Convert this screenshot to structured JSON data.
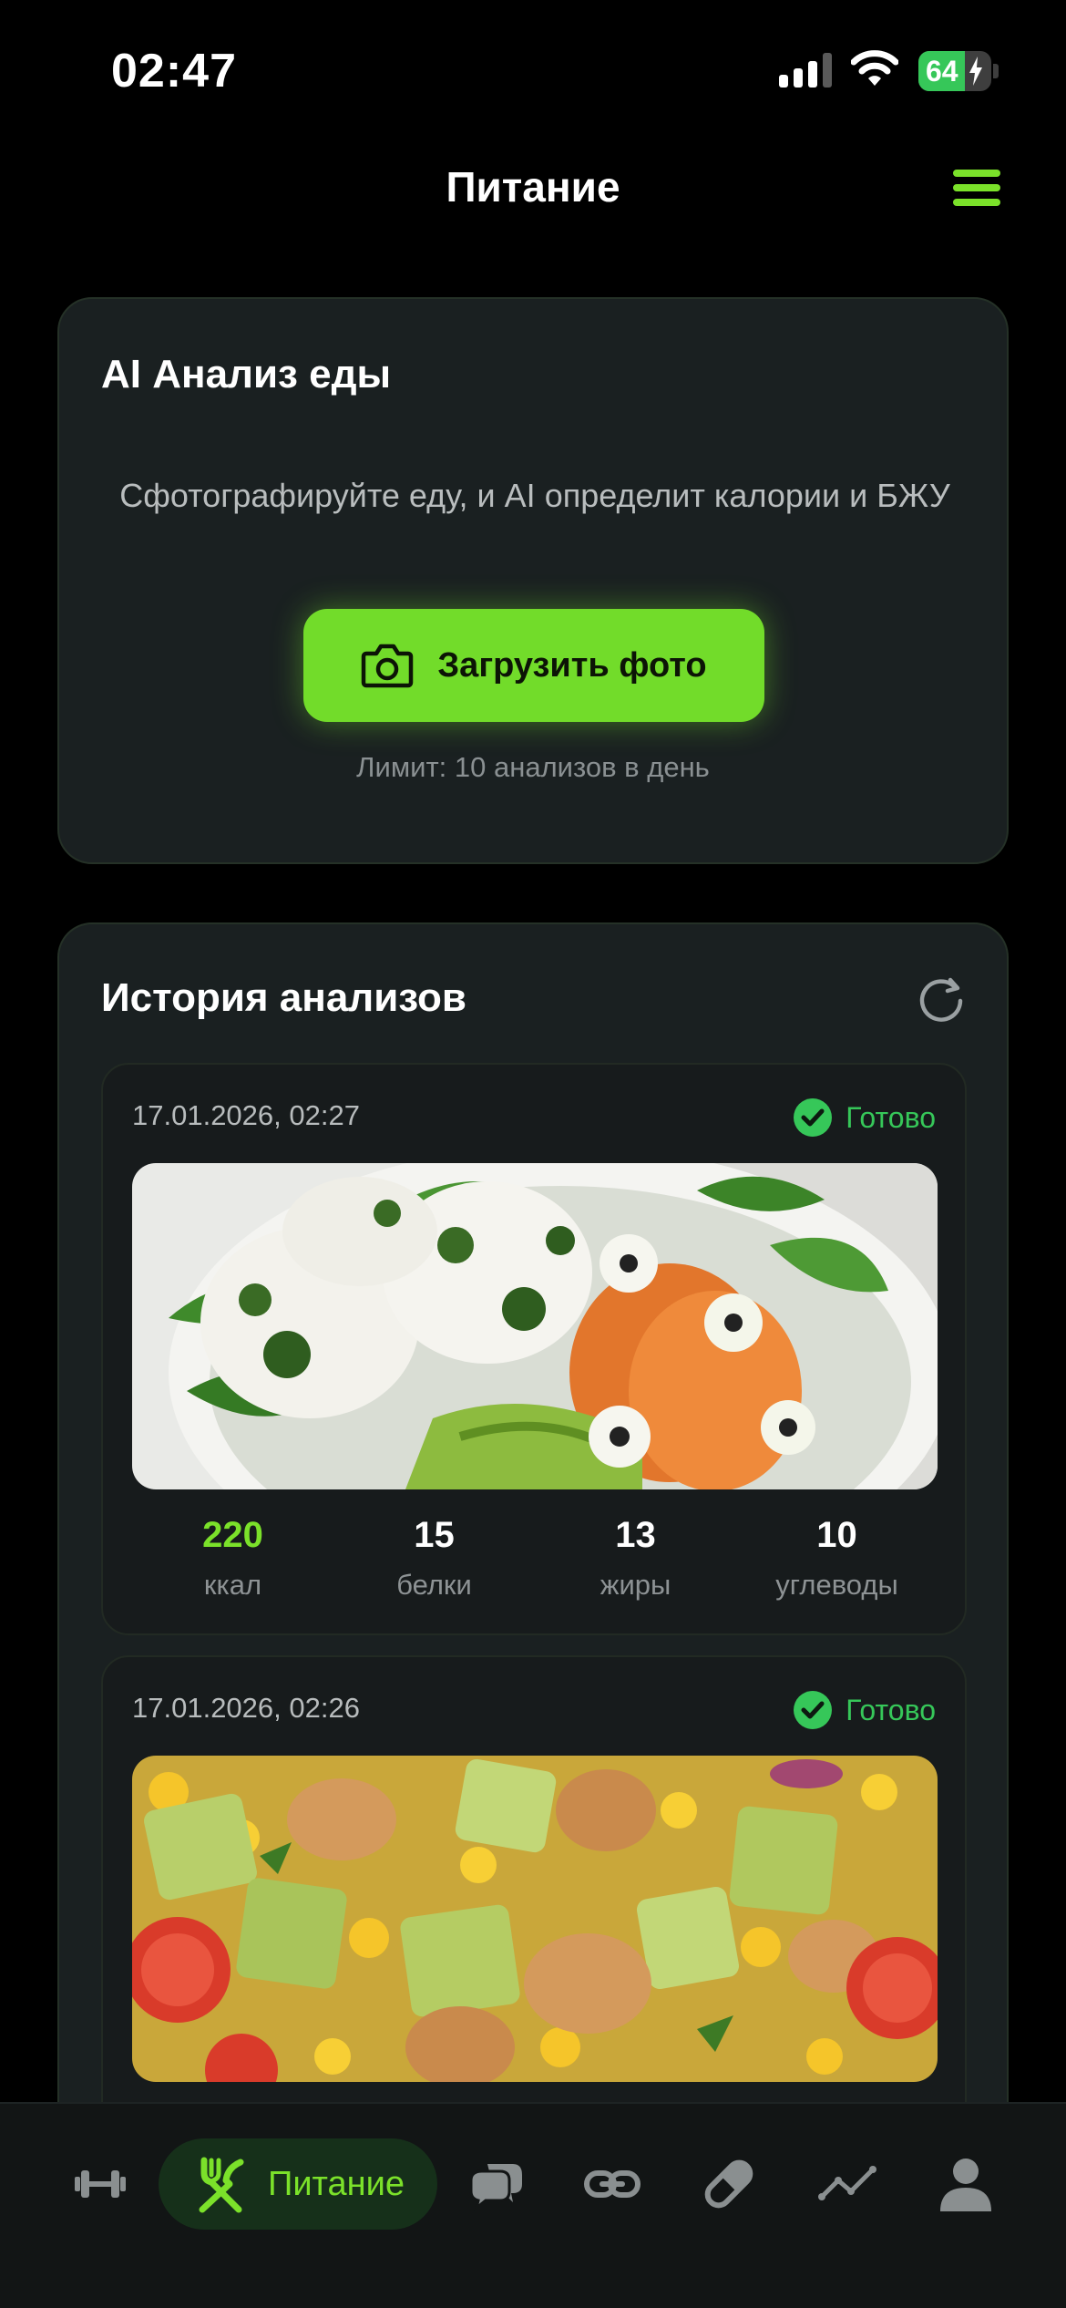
{
  "status_bar": {
    "time": "02:47",
    "battery": "64",
    "battery_level": 0.64
  },
  "header": {
    "title": "Питание"
  },
  "ai_card": {
    "title": "AI Анализ еды",
    "description": "Сфотографируйте еду, и AI определит калории и БЖУ",
    "upload_label": "Загрузить фото",
    "limit": "Лимит: 10 анализов в день"
  },
  "history": {
    "title": "История анализов",
    "items": [
      {
        "date": "17.01.2026, 02:27",
        "status": "Готово",
        "macros": [
          {
            "value": "220",
            "label": "ккал"
          },
          {
            "value": "15",
            "label": "белки"
          },
          {
            "value": "13",
            "label": "жиры"
          },
          {
            "value": "10",
            "label": "углеводы"
          }
        ]
      },
      {
        "date": "17.01.2026, 02:26",
        "status": "Готово"
      }
    ]
  },
  "tab_bar": {
    "active_label": "Питание",
    "tabs": [
      "dumbbell-icon",
      "fork-knife-icon",
      "chat-icon",
      "link-icon",
      "pill-icon",
      "chart-icon",
      "profile-icon"
    ]
  },
  "colors": {
    "accent": "#72dc2a",
    "success": "#36c759",
    "card": "#1a2021",
    "background": "#000000"
  }
}
